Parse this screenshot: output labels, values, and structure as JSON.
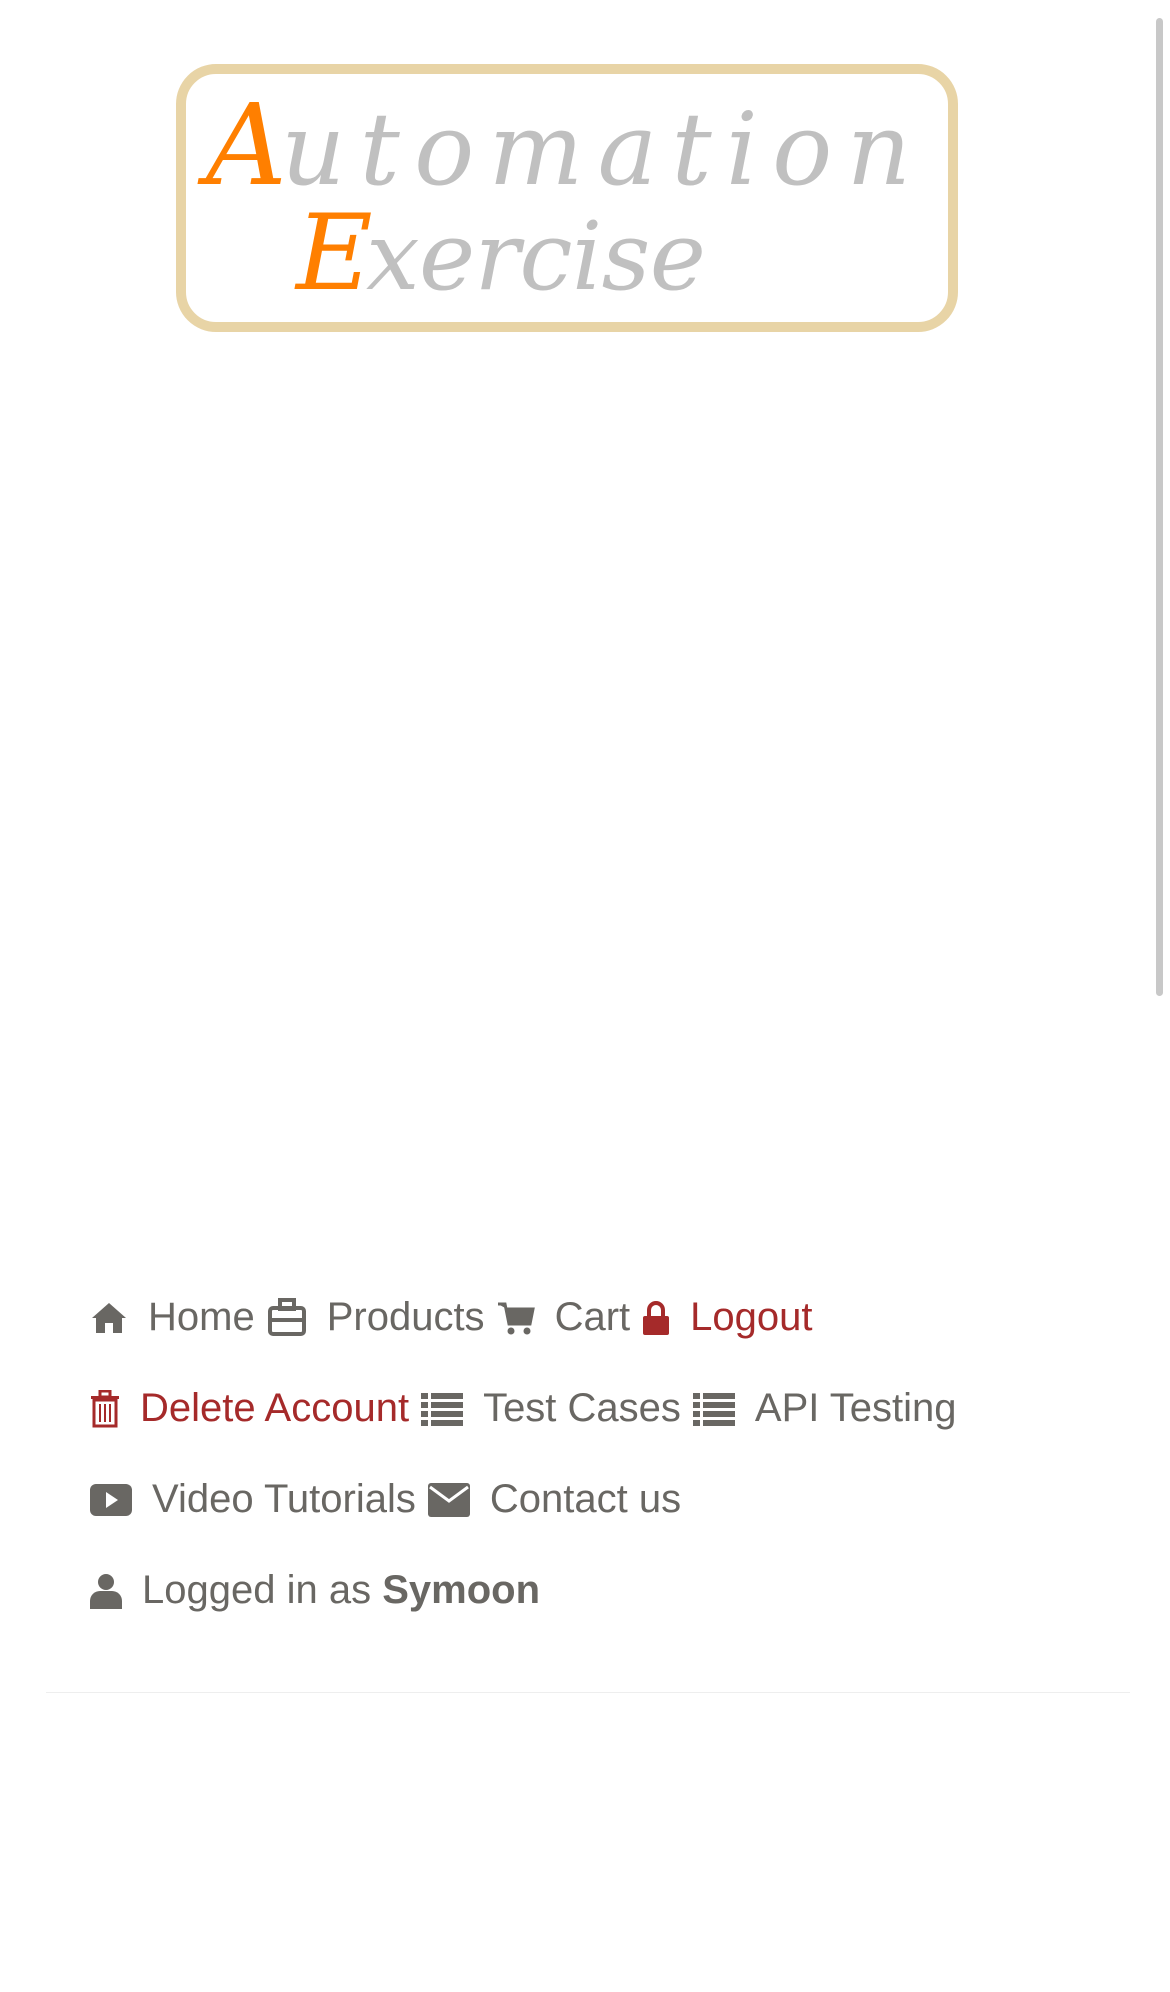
{
  "logo": {
    "text_line1": "Automation",
    "text_line2": "Exercise",
    "colors": {
      "accent": "#ff7f00",
      "text": "#c0c0c0",
      "border": "#e8d4a6"
    }
  },
  "nav": {
    "items": [
      {
        "label": "Home",
        "icon": "home-icon"
      },
      {
        "label": "Products",
        "icon": "briefcase-icon"
      },
      {
        "label": "Cart",
        "icon": "shopping-cart-icon"
      },
      {
        "label": "Logout",
        "icon": "lock-icon"
      },
      {
        "label": "Delete Account",
        "icon": "trash-icon"
      },
      {
        "label": "Test Cases",
        "icon": "list-icon"
      },
      {
        "label": "API Testing",
        "icon": "list-icon"
      },
      {
        "label": "Video Tutorials",
        "icon": "youtube-play-icon"
      },
      {
        "label": "Contact us",
        "icon": "envelope-icon"
      }
    ],
    "logged_in_prefix": "Logged in as",
    "username": "Symoon"
  },
  "colors": {
    "text": "#696763",
    "danger": "#a52a2a"
  }
}
